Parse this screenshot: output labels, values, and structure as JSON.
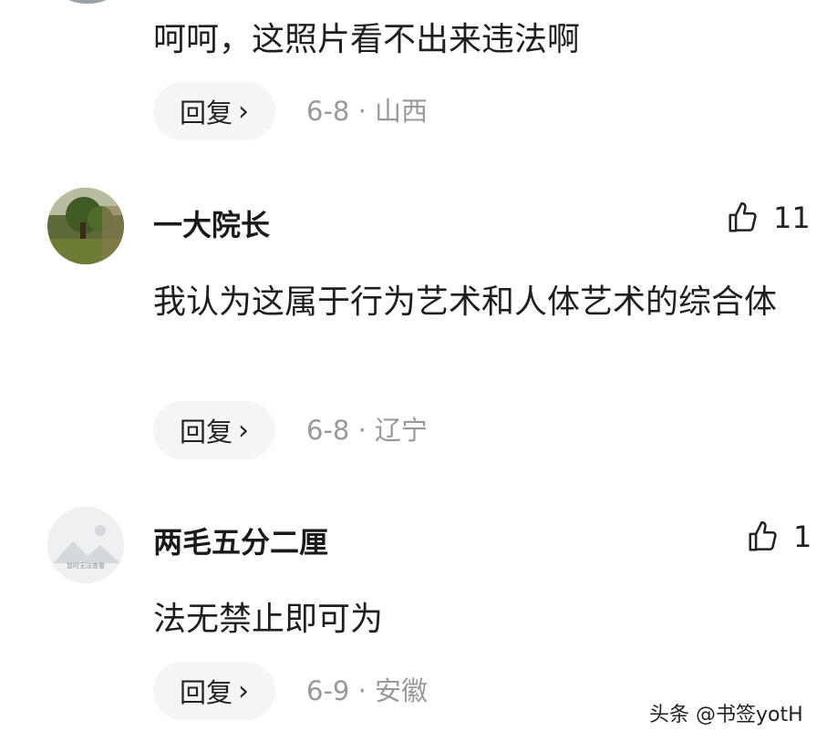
{
  "comments": [
    {
      "text": "呵呵，这照片看不出来违法啊",
      "reply_label": "回复",
      "date": "6-8",
      "location": "山西"
    },
    {
      "username": "一大院长",
      "likes": "11",
      "text": "我认为这属于行为艺术和人体艺术的综合体",
      "reply_label": "回复",
      "date": "6-8",
      "location": "辽宁"
    },
    {
      "username": "两毛五分二厘",
      "avatar_caption": "暂时无法查看",
      "likes": "1",
      "text": "法无禁止即可为",
      "reply_label": "回复",
      "date": "6-9",
      "location": "安徽"
    }
  ],
  "separator": "·",
  "chevron": "›",
  "watermark": "头条 @书签yotH",
  "icons": {
    "like": "thumbs-up-icon",
    "reply_chevron": "chevron-right-icon"
  },
  "colors": {
    "meta": "#999999",
    "pill_bg": "#f5f5f5"
  }
}
